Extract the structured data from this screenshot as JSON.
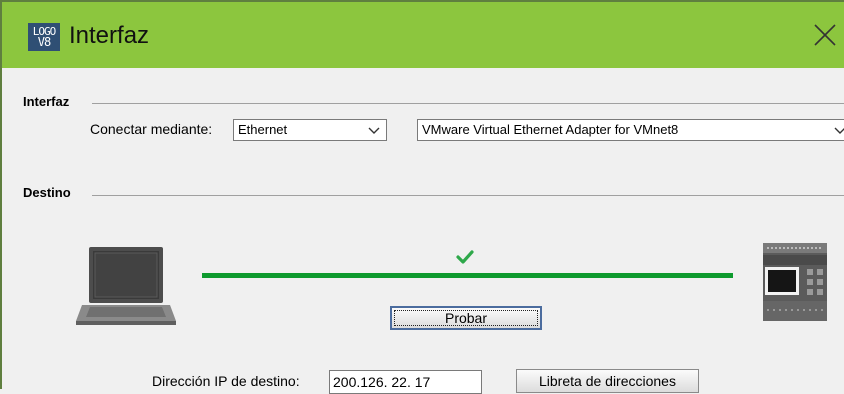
{
  "window": {
    "title": "Interfaz",
    "logo_line1": "LOGO",
    "logo_line2": "V8"
  },
  "interface_group": {
    "label": "Interfaz",
    "connect_label": "Conectar mediante:",
    "connect_value": "Ethernet",
    "adapter_value": "VMware Virtual Ethernet Adapter for VMnet8"
  },
  "target_group": {
    "label": "Destino",
    "connection_status": "ok",
    "test_button": "Probar",
    "ip_label": "Dirección IP de destino:",
    "ip_value": "200.126. 22. 17",
    "address_book_button": "Libreta de direcciones"
  },
  "colors": {
    "titlebar": "#8cc63e",
    "link": "#0e9a2e",
    "check": "#2ea84a"
  },
  "icons": [
    "logo-app-icon",
    "close-icon",
    "chevron-down-icon",
    "laptop-icon",
    "checkmark-icon",
    "plc-device-icon"
  ]
}
